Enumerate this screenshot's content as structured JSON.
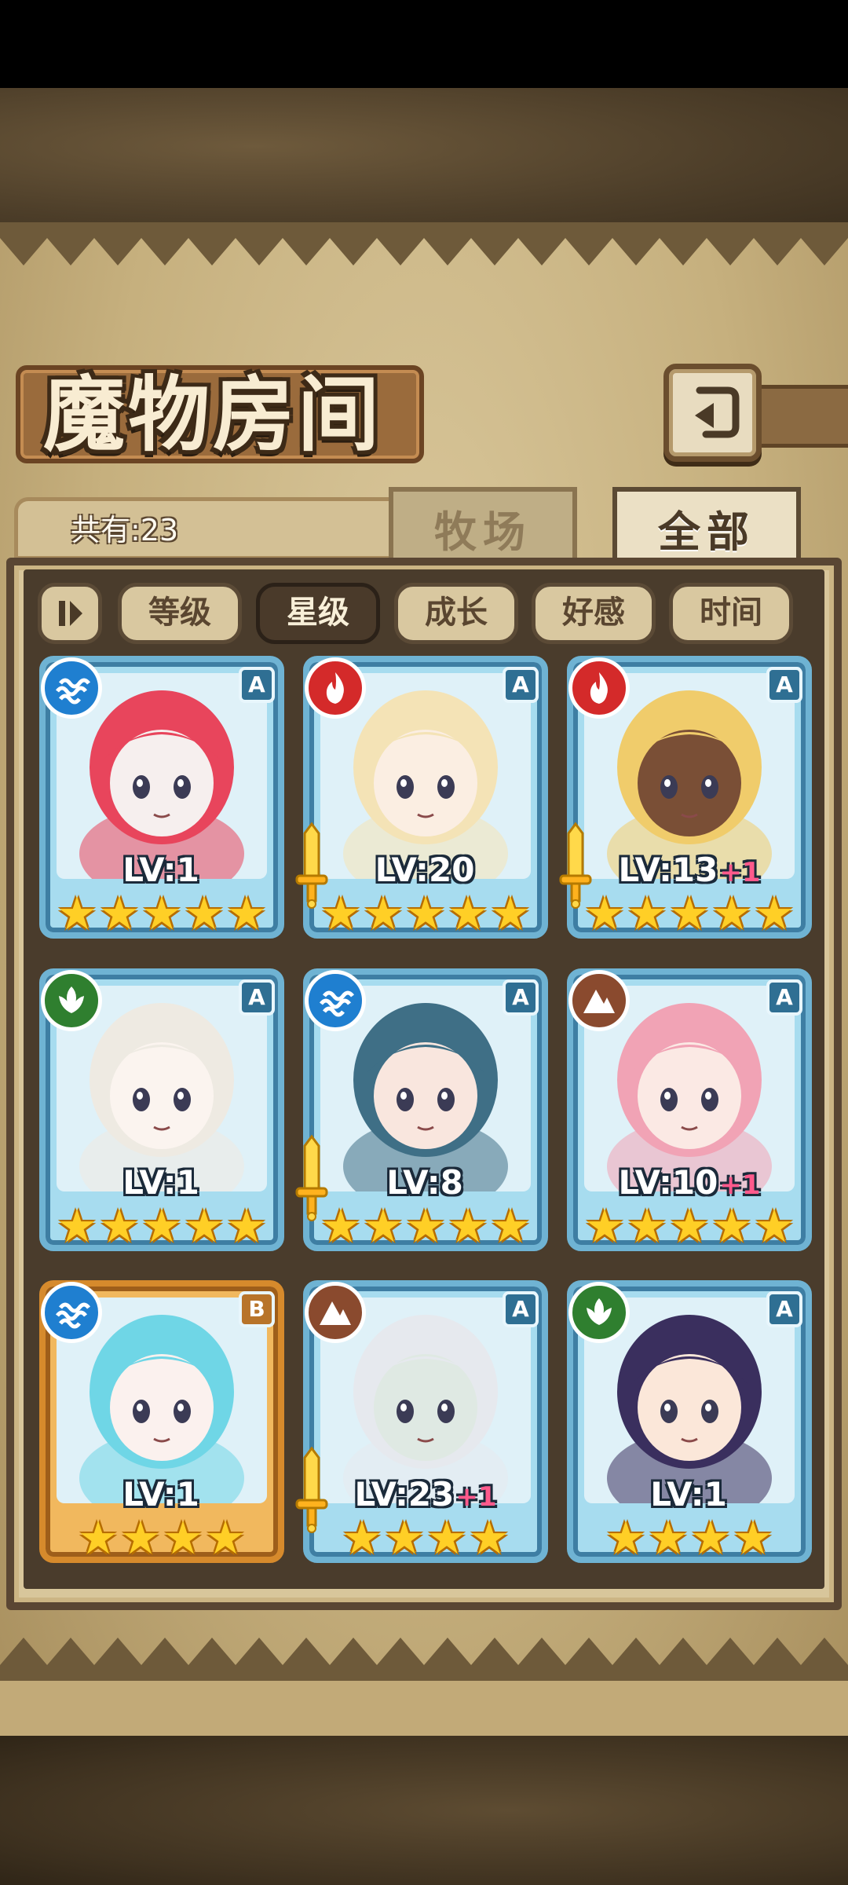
{
  "header": {
    "title": "魔物房间"
  },
  "summary": {
    "count_label": "共有:23"
  },
  "tabs": [
    {
      "label": "牧场",
      "active": false
    },
    {
      "label": "全部",
      "active": true
    }
  ],
  "sort": {
    "buttons": [
      {
        "label": "等级",
        "active": false
      },
      {
        "label": "星级",
        "active": true
      },
      {
        "label": "成长",
        "active": false
      },
      {
        "label": "好感",
        "active": false
      },
      {
        "label": "时间",
        "active": false
      }
    ]
  },
  "monsters": [
    {
      "level": "LV:1",
      "bonus": "",
      "stars": 5,
      "rarity": "A",
      "element": "water",
      "has_sword": false,
      "frame": "blue",
      "hair": "#e8455c",
      "skin": "#f6efee"
    },
    {
      "level": "LV:20",
      "bonus": "",
      "stars": 5,
      "rarity": "A",
      "element": "fire",
      "has_sword": true,
      "frame": "blue",
      "hair": "#f4e3b6",
      "skin": "#fbeee2"
    },
    {
      "level": "LV:13",
      "bonus": "+1",
      "stars": 5,
      "rarity": "A",
      "element": "fire",
      "has_sword": true,
      "frame": "blue",
      "hair": "#f0cc6b",
      "skin": "#7a4f36"
    },
    {
      "level": "LV:1",
      "bonus": "",
      "stars": 5,
      "rarity": "A",
      "element": "wood",
      "has_sword": false,
      "frame": "blue",
      "hair": "#eeeae2",
      "skin": "#fbf4ef"
    },
    {
      "level": "LV:8",
      "bonus": "",
      "stars": 5,
      "rarity": "A",
      "element": "water",
      "has_sword": true,
      "frame": "blue",
      "hair": "#3f6f86",
      "skin": "#f9e6de"
    },
    {
      "level": "LV:10",
      "bonus": "+1",
      "stars": 5,
      "rarity": "A",
      "element": "earth",
      "has_sword": false,
      "frame": "blue",
      "hair": "#f1a3b5",
      "skin": "#fbe9e4"
    },
    {
      "level": "LV:1",
      "bonus": "",
      "stars": 4,
      "rarity": "B",
      "element": "water",
      "has_sword": false,
      "frame": "orange",
      "hair": "#6fd6e6",
      "skin": "#fbf1ee"
    },
    {
      "level": "LV:23",
      "bonus": "+1",
      "stars": 4,
      "rarity": "A",
      "element": "earth",
      "has_sword": true,
      "frame": "blue",
      "hair": "#e6e9ee",
      "skin": "#dfe9e3"
    },
    {
      "level": "LV:1",
      "bonus": "",
      "stars": 4,
      "rarity": "A",
      "element": "wood",
      "has_sword": false,
      "frame": "blue",
      "hair": "#3a2f5e",
      "skin": "#fbe7d9"
    }
  ],
  "colors": {
    "panel_border": "#5a4633",
    "card_blue": "#a7dcef",
    "card_orange": "#f1b85e",
    "star": "#ffcf26",
    "bonus": "#ff5a8c"
  }
}
